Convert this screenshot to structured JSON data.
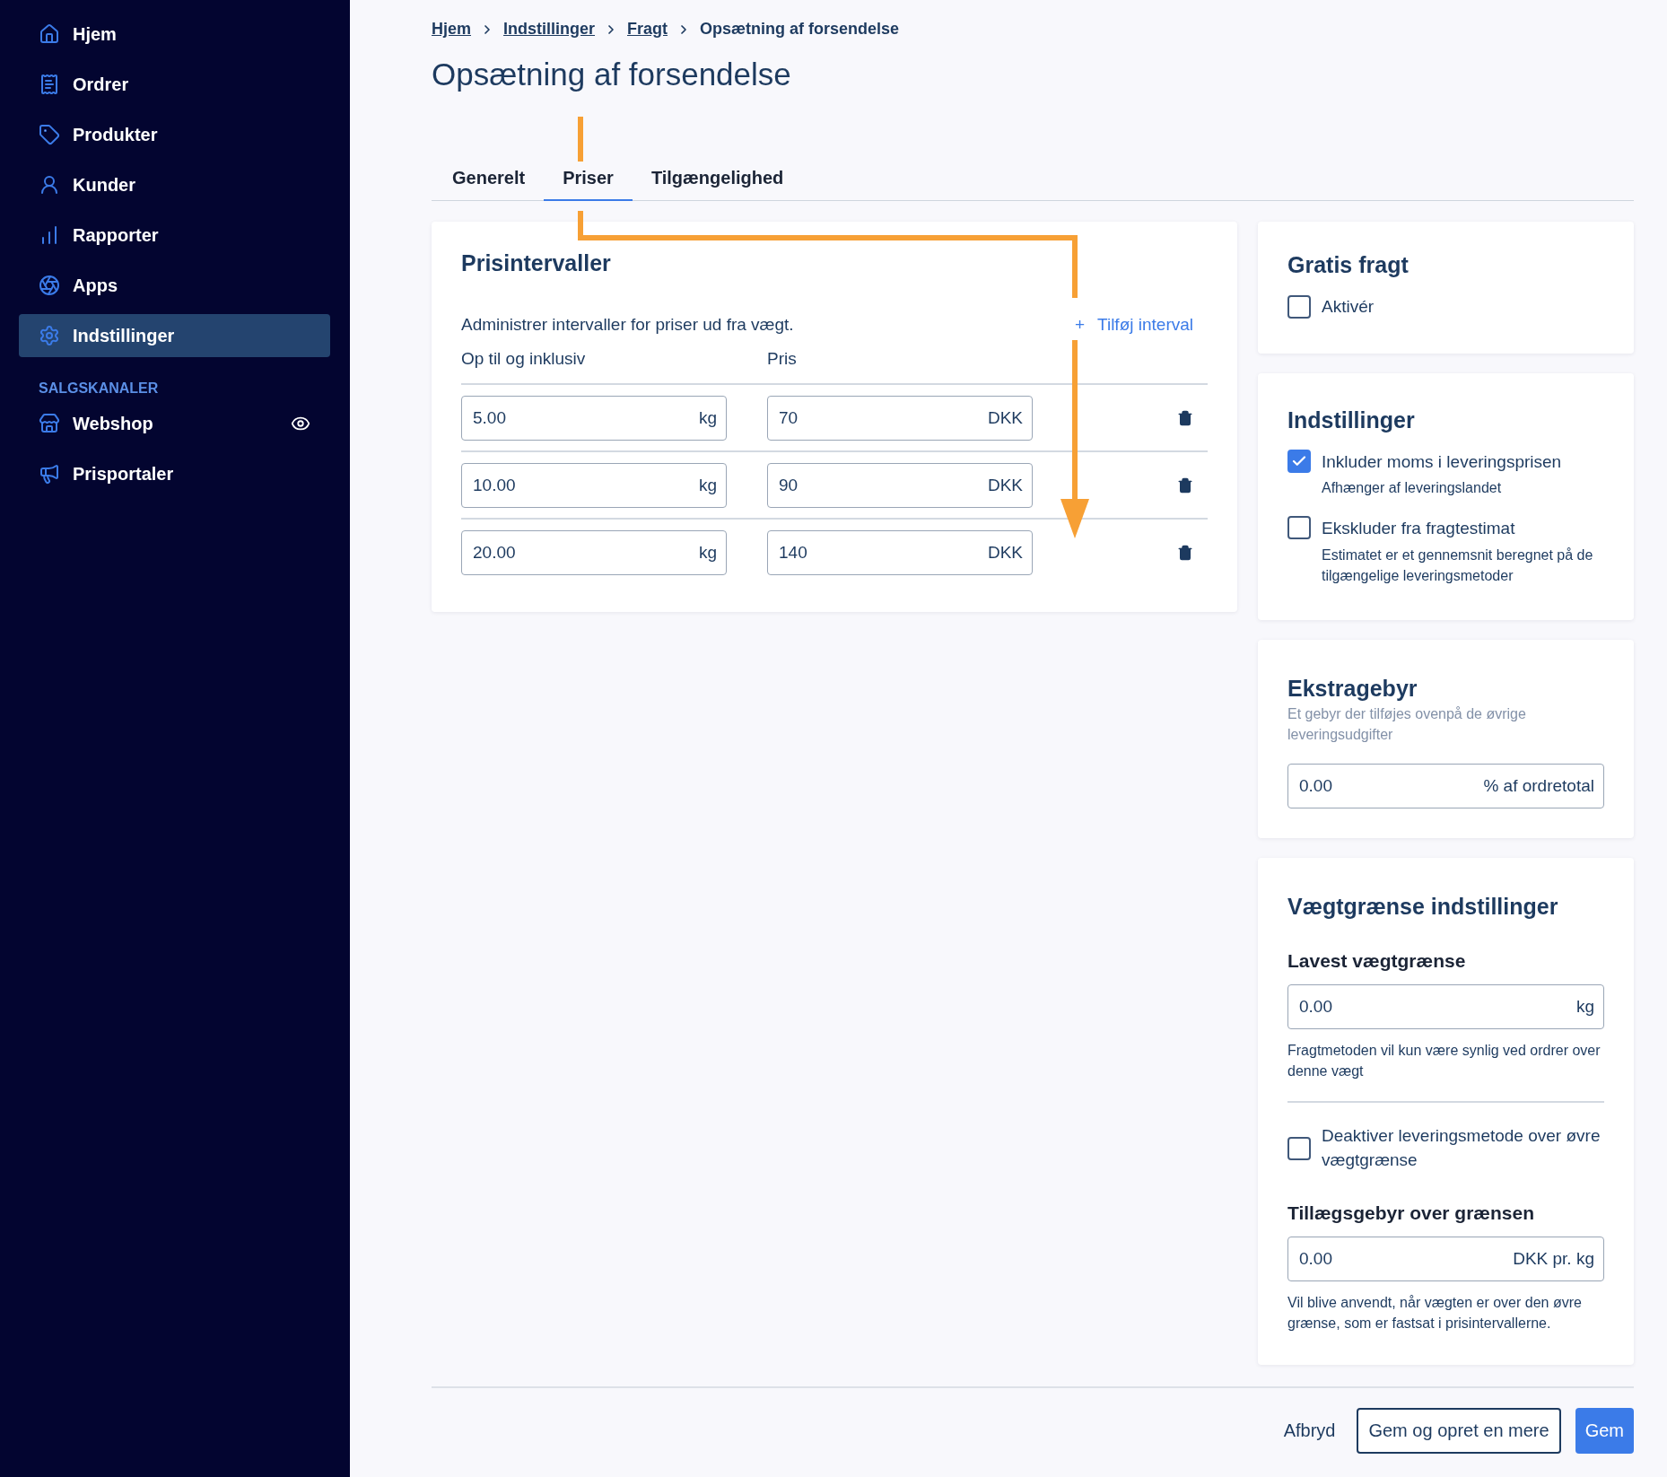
{
  "sidebar": {
    "items": [
      {
        "label": "Hjem",
        "selected": false
      },
      {
        "label": "Ordrer",
        "selected": false
      },
      {
        "label": "Produkter",
        "selected": false
      },
      {
        "label": "Kunder",
        "selected": false
      },
      {
        "label": "Rapporter",
        "selected": false
      },
      {
        "label": "Apps",
        "selected": false
      },
      {
        "label": "Indstillinger",
        "selected": true
      }
    ],
    "section_title": "SALGSKANALER",
    "channels": [
      {
        "label": "Webshop",
        "selected": false,
        "preview_visible": true
      },
      {
        "label": "Prisportaler",
        "selected": false,
        "preview_visible": false
      }
    ]
  },
  "breadcrumb": {
    "links": [
      "Hjem",
      "Indstillinger",
      "Fragt"
    ],
    "current": "Opsætning af forsendelse"
  },
  "page_title": "Opsætning af forsendelse",
  "tabs": [
    {
      "label": "Generelt",
      "selected": false
    },
    {
      "label": "Priser",
      "selected": true
    },
    {
      "label": "Tilgængelighed",
      "selected": false
    }
  ],
  "price_intervals": {
    "title": "Prisintervaller",
    "description": "Administrer intervaller for priser ud fra vægt.",
    "add_button": {
      "icon": "+",
      "label": "Tilføj interval"
    },
    "columns": [
      "Op til og inklusiv",
      "Pris"
    ],
    "rows": [
      {
        "weight": "5.00",
        "weight_unit": "kg",
        "price": "70",
        "price_unit": "DKK"
      },
      {
        "weight": "10.00",
        "weight_unit": "kg",
        "price": "90",
        "price_unit": "DKK"
      },
      {
        "weight": "20.00",
        "weight_unit": "kg",
        "price": "140",
        "price_unit": "DKK"
      }
    ]
  },
  "free_shipping": {
    "title": "Gratis fragt",
    "checkbox": {
      "label": "Aktivér",
      "checked": false
    }
  },
  "settings": {
    "title": "Indstillinger",
    "options": [
      {
        "label": "Inkluder moms i leveringsprisen",
        "hint": "Afhænger af leveringslandet",
        "checked": true
      },
      {
        "label": "Ekskluder fra fragtestimat",
        "hint": "Estimatet er et gennemsnit beregnet på de tilgængelige leveringsmetoder",
        "checked": false
      }
    ]
  },
  "extra_fee": {
    "title": "Ekstragebyr",
    "description": "Et gebyr der tilføjes ovenpå de øvrige leveringsudgifter",
    "field": {
      "value": "0.00",
      "unit": "% af ordretotal"
    }
  },
  "weight_limits": {
    "title": "Vægtgrænse indstillinger",
    "lowest": {
      "label": "Lavest vægtgrænse",
      "value": "0.00",
      "unit": "kg",
      "hint": "Fragtmetoden vil kun være synlig ved ordrer over denne vægt"
    },
    "disable_option": {
      "label": "Deaktiver leveringsmetode over øvre vægtgrænse",
      "checked": false
    },
    "surcharge": {
      "label": "Tillægsgebyr over grænsen",
      "value": "0.00",
      "unit": "DKK pr. kg",
      "hint": "Vil blive anvendt, når vægten er over den øvre grænse, som er fastsat i prisintervallerne."
    }
  },
  "footer": {
    "buttons": [
      {
        "label": "Afbryd",
        "kind": "text"
      },
      {
        "label": "Gem og opret en mere",
        "kind": "outline"
      },
      {
        "label": "Gem",
        "kind": "primary"
      }
    ]
  }
}
